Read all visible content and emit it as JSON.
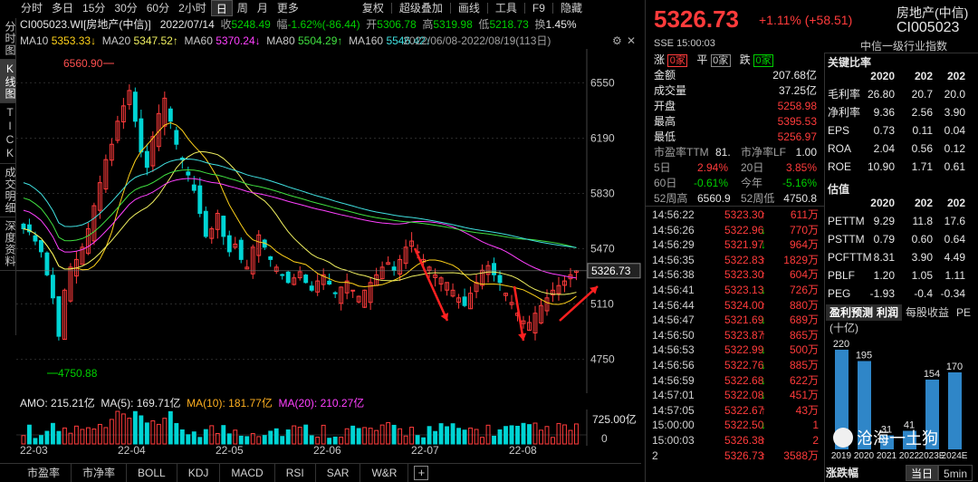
{
  "toolbar": {
    "items": [
      "分时",
      "多日",
      "15分",
      "30分",
      "60分",
      "2小时",
      "日",
      "周",
      "月",
      "更多"
    ],
    "active_index": 6,
    "right_items": [
      "复权",
      "超级叠加",
      "画线",
      "工具",
      "F9",
      "隐藏"
    ]
  },
  "vtabs": [
    "分时图",
    "K线图",
    "TICK",
    "成交明细",
    "深度资料"
  ],
  "info": {
    "code": "CI005023.WI[房地产(中信)]",
    "date": "2022/07/14",
    "close_label": "收",
    "close": "5248.49",
    "change_label": "幅",
    "change": "-1.62%(-86.44)",
    "open_label": "开",
    "open": "5306.78",
    "high_label": "高",
    "high": "5319.98",
    "low_label": "低",
    "low": "5218.73",
    "turnover_label": "换",
    "turnover": "1.45%"
  },
  "ma": {
    "items": [
      {
        "label": "MA10",
        "value": "5353.33↓",
        "color": "#ffd21a"
      },
      {
        "label": "MA20",
        "value": "5347.52↑",
        "color": "#f0f060"
      },
      {
        "label": "MA60",
        "value": "5370.24↓",
        "color": "#ff40ff"
      },
      {
        "label": "MA80",
        "value": "5504.29↑",
        "color": "#40e040"
      },
      {
        "label": "MA160",
        "value": "5546.42↓",
        "color": "#40e0e0"
      }
    ],
    "range": "2022/06/08-2022/08/19(113日)"
  },
  "chart_data": {
    "type": "candlestick",
    "y_ticks": [
      "6550",
      "6190",
      "5830",
      "5470",
      "5110",
      "4750"
    ],
    "ylim": [
      4600,
      6700
    ],
    "x_ticks": [
      "22-03",
      "22-04",
      "22-05",
      "22-06",
      "22-07",
      "22-08"
    ],
    "high_label": "6560.90",
    "low_label": "4750.88",
    "last_price": "5326.73",
    "closes": [
      5600,
      5580,
      5520,
      5450,
      5300,
      5150,
      4900,
      5200,
      5350,
      5400,
      5480,
      5600,
      5750,
      5900,
      6050,
      6150,
      6300,
      6400,
      6500,
      6300,
      6100,
      6000,
      6200,
      6350,
      6450,
      6300,
      6150,
      6050,
      5950,
      5850,
      5700,
      5550,
      5600,
      5700,
      5550,
      5450,
      5500,
      5400,
      5350,
      5480,
      5560,
      5480,
      5400,
      5350,
      5300,
      5250,
      5280,
      5320,
      5250,
      5200,
      5260,
      5300,
      5240,
      5180,
      5220,
      5260,
      5200,
      5160,
      5200,
      5250,
      5300,
      5350,
      5380,
      5330,
      5400,
      5480,
      5520,
      5450,
      5400,
      5350,
      5300,
      5280,
      5250,
      5200,
      5150,
      5100,
      5180,
      5250,
      5330,
      5360,
      5300,
      5250,
      5180,
      5120,
      5050,
      5000,
      4990,
      5050,
      5100,
      5150,
      5200,
      5230,
      5260,
      5300,
      5327
    ],
    "volume": {
      "amo": "215.21亿",
      "ma5": "169.71亿",
      "ma10": "181.77亿",
      "ma20": "210.27亿",
      "max_label": "725.00亿",
      "zero_label": "0"
    }
  },
  "bottom_tabs": [
    "市盈率",
    "市净率",
    "BOLL",
    "KDJ",
    "MACD",
    "RSI",
    "SAR",
    "W&R"
  ],
  "quote": {
    "price": "5326.73",
    "change": "+1.11% (+58.51)",
    "name": "房地产(中信)",
    "code": "CI005023",
    "exchange_time": "SSE  15:00:03",
    "sector": "中信一级行业指数",
    "up_label": "涨",
    "up_val": "0家",
    "flat_label": "平",
    "flat_val": "0家",
    "down_label": "跌",
    "down_val": "0家",
    "rows": [
      {
        "k": "金额",
        "v": "207.68亿",
        "c": "white"
      },
      {
        "k": "成交量",
        "v": "37.25亿",
        "c": "white"
      },
      {
        "k": "开盘",
        "v": "5258.98",
        "c": "red"
      },
      {
        "k": "最高",
        "v": "5395.53",
        "c": "red"
      },
      {
        "k": "最低",
        "v": "5256.97",
        "c": "red"
      }
    ],
    "pe_label": "市盈率TTM",
    "pe_val": "81.",
    "pb_label": "市净率LF",
    "pb_val": "1.00",
    "d5_label": "5日",
    "d5": "2.94%",
    "d20_label": "20日",
    "d20": "3.85%",
    "d60_label": "60日",
    "d60": "-0.61%",
    "ytd_label": "今年",
    "ytd": "-5.16%",
    "h52_label": "52周高",
    "h52": "6560.9",
    "l52_label": "52周低",
    "l52": "4750.8"
  },
  "ticks": [
    {
      "t": "14:56:22",
      "p": "5323.30",
      "a": "up",
      "v": "611万"
    },
    {
      "t": "14:56:26",
      "p": "5322.96",
      "a": "down",
      "v": "770万"
    },
    {
      "t": "14:56:29",
      "p": "5321.97",
      "a": "down",
      "v": "964万"
    },
    {
      "t": "14:56:35",
      "p": "5322.83",
      "a": "up",
      "v": "1829万"
    },
    {
      "t": "14:56:38",
      "p": "5323.30",
      "a": "up",
      "v": "604万"
    },
    {
      "t": "14:56:41",
      "p": "5323.13",
      "a": "down",
      "v": "726万"
    },
    {
      "t": "14:56:44",
      "p": "5324.00",
      "a": "up",
      "v": "880万"
    },
    {
      "t": "14:56:47",
      "p": "5321.69",
      "a": "down",
      "v": "689万"
    },
    {
      "t": "14:56:50",
      "p": "5323.87",
      "a": "up",
      "v": "865万"
    },
    {
      "t": "14:56:53",
      "p": "5322.99",
      "a": "down",
      "v": "500万"
    },
    {
      "t": "14:56:56",
      "p": "5322.76",
      "a": "down",
      "v": "885万"
    },
    {
      "t": "14:56:59",
      "p": "5322.68",
      "a": "down",
      "v": "622万"
    },
    {
      "t": "14:57:01",
      "p": "5322.08",
      "a": "down",
      "v": "451万"
    },
    {
      "t": "14:57:05",
      "p": "5322.67",
      "a": "up",
      "v": "43万"
    },
    {
      "t": "15:00:00",
      "p": "5322.50",
      "a": "down",
      "v": "1"
    },
    {
      "t": "15:00:03",
      "p": "5326.38",
      "a": "up",
      "v": "2"
    },
    {
      "t": "2",
      "p": "5326.73",
      "a": "up",
      "v": "3588万"
    }
  ],
  "ratios": {
    "title": "关键比率",
    "years": [
      "2020",
      "202",
      "202"
    ],
    "rows": [
      {
        "k": "毛利率",
        "v": [
          "26.80",
          "20.7",
          "20.0"
        ]
      },
      {
        "k": "净利率",
        "v": [
          "9.36",
          "2.56",
          "3.90"
        ]
      },
      {
        "k": "EPS",
        "v": [
          "0.73",
          "0.11",
          "0.04"
        ]
      },
      {
        "k": "ROA",
        "v": [
          "2.04",
          "0.56",
          "0.12"
        ]
      },
      {
        "k": "ROE",
        "v": [
          "10.90",
          "1.71",
          "0.61"
        ]
      }
    ]
  },
  "valuation": {
    "title": "估值",
    "years": [
      "2020",
      "202",
      "202"
    ],
    "rows": [
      {
        "k": "PETTM",
        "v": [
          "9.29",
          "11.8",
          "17.6"
        ]
      },
      {
        "k": "PSTTM",
        "v": [
          "0.79",
          "0.60",
          "0.64"
        ]
      },
      {
        "k": "PCFTTM",
        "v": [
          "8.31",
          "3.90",
          "4.49"
        ]
      },
      {
        "k": "PBLF",
        "v": [
          "1.20",
          "1.05",
          "1.11"
        ]
      },
      {
        "k": "PEG",
        "v": [
          "-1.93",
          "-0.4",
          "-0.34"
        ]
      }
    ]
  },
  "forecast": {
    "tabs": [
      "盈利预测",
      "利润",
      "每股收益",
      "PE"
    ],
    "unit": "(十亿)",
    "labels": [
      "2019",
      "2020",
      "2021",
      "2022",
      "2023E",
      "2024E"
    ],
    "values": [
      220,
      195,
      31,
      41,
      154,
      170
    ],
    "value_labels": [
      "220",
      "195",
      "31",
      "41",
      "154",
      "170"
    ]
  },
  "watermark": "沧海一土狗",
  "footer": {
    "label": "涨跌幅",
    "tabs": [
      "当日",
      "5min"
    ]
  }
}
